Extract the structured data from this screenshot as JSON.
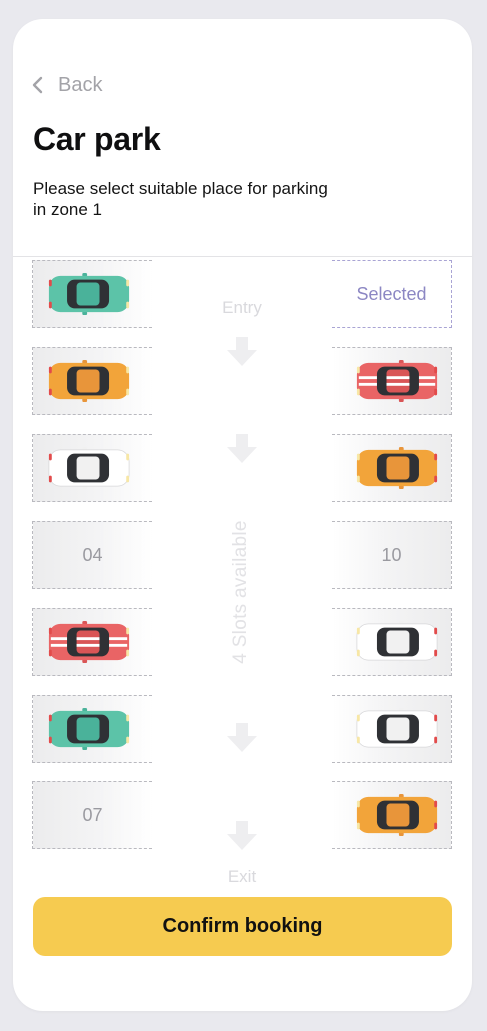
{
  "header": {
    "back_label": "Back",
    "title": "Car park",
    "subtitle": "Please select suitable place for parking in zone 1"
  },
  "lot": {
    "entry_label": "Entry",
    "exit_label": "Exit",
    "availability_label": "4 Slots available",
    "left_slots": [
      {
        "state": "occupied",
        "car": "teal"
      },
      {
        "state": "occupied",
        "car": "orange"
      },
      {
        "state": "occupied",
        "car": "white"
      },
      {
        "state": "free",
        "label": "04"
      },
      {
        "state": "occupied",
        "car": "red"
      },
      {
        "state": "occupied",
        "car": "teal"
      },
      {
        "state": "free",
        "label": "07"
      }
    ],
    "right_slots": [
      {
        "state": "selected",
        "label": "Selected"
      },
      {
        "state": "occupied",
        "car": "red"
      },
      {
        "state": "occupied",
        "car": "orange"
      },
      {
        "state": "free",
        "label": "10"
      },
      {
        "state": "occupied",
        "car": "white"
      },
      {
        "state": "occupied",
        "car": "white"
      },
      {
        "state": "occupied",
        "car": "orange"
      }
    ]
  },
  "colors": {
    "accent": "#f6cb50",
    "selected": "#8c87c3",
    "car_teal": "#5cc3a8",
    "car_orange": "#f2a43a",
    "car_red": "#e96465",
    "car_white": "#ffffff"
  },
  "actions": {
    "confirm_label": "Confirm booking"
  }
}
